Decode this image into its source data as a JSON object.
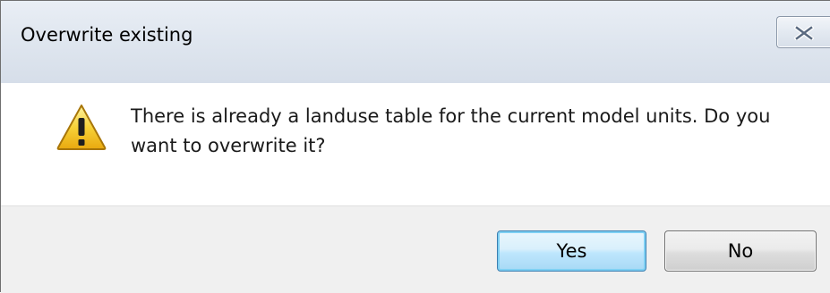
{
  "window": {
    "title": "Overwrite existing",
    "close_icon": "close-icon"
  },
  "message": {
    "icon": "warning-icon",
    "text": "There is already a landuse table for the current model units. Do you want to overwrite it?"
  },
  "buttons": {
    "yes_label": "Yes",
    "no_label": "No"
  },
  "colors": {
    "titlebar": "#dfe6ef",
    "footer": "#f0f0f0",
    "default_button_border": "#3c7fb1",
    "warning_fill": "#f5c518"
  }
}
